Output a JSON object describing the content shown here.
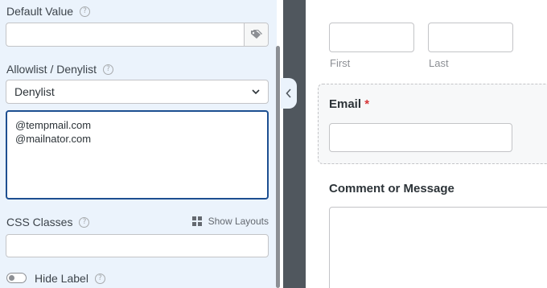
{
  "settings": {
    "default_value": {
      "label": "Default Value",
      "value": ""
    },
    "allowlist": {
      "label": "Allowlist / Denylist",
      "selected": "Denylist",
      "entries": [
        "@tempmail.com",
        "@mailnator.com"
      ]
    },
    "css_classes": {
      "label": "CSS Classes",
      "value": "",
      "show_layouts": "Show Layouts"
    },
    "hide_label": {
      "label": "Hide Label",
      "checked": false
    }
  },
  "preview": {
    "name_sublabels": {
      "first": "First",
      "last": "Last"
    },
    "email": {
      "label": "Email",
      "required_marker": "*"
    },
    "comment": {
      "label": "Comment or Message"
    }
  },
  "icons": [
    "help-icon",
    "tag-icon",
    "chevron-down-icon",
    "grid-icon",
    "chevron-left-icon"
  ],
  "colors": {
    "panel_bg": "#ebf3fc",
    "divider": "#50575e",
    "focus_border": "#1d4f91",
    "required": "#d63638"
  }
}
